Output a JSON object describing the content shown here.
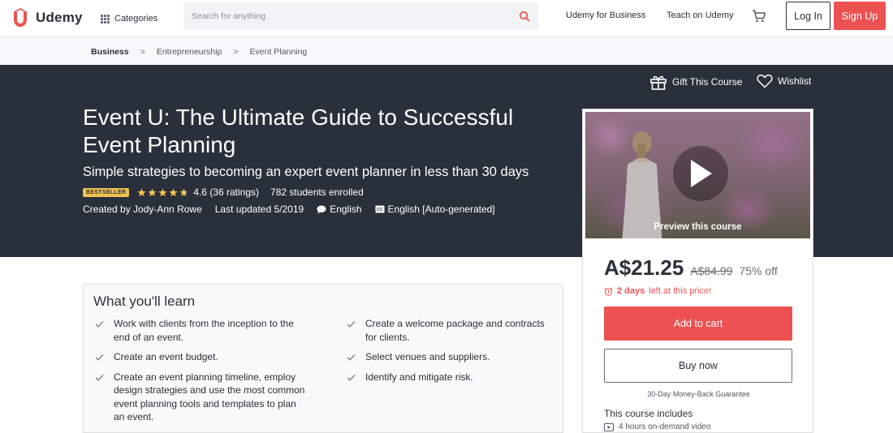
{
  "header": {
    "logo_text": "Udemy",
    "categories_label": "Categories",
    "search_placeholder": "Search for anything",
    "business_link": "Udemy for Business",
    "teach_link": "Teach on Udemy",
    "login_label": "Log In",
    "signup_label": "Sign Up"
  },
  "breadcrumb": [
    "Business",
    "Entrepreneurship",
    "Event Planning"
  ],
  "breadcrumb_separator": ">",
  "hero": {
    "gift_label": "Gift This Course",
    "wishlist_label": "Wishlist",
    "title": "Event U: The Ultimate Guide to Successful Event Planning",
    "subtitle": "Simple strategies to becoming an expert event planner in less than 30 days",
    "badge": "BESTSELLER",
    "rating": "4.6 (36 ratings)",
    "rating_value": 4.6,
    "students": "782 students enrolled",
    "created_by": "Created by Jody-Ann Rowe",
    "last_updated": "Last updated 5/2019",
    "language": "English",
    "captions": "English [Auto-generated]"
  },
  "sidebar": {
    "preview_label": "Preview this course",
    "price_current": "A$21.25",
    "price_original": "A$84.99",
    "discount": "75% off",
    "timer_bold": "2 days",
    "timer_rest": "left at this price!",
    "add_to_cart": "Add to cart",
    "buy_now": "Buy now",
    "guarantee": "30-Day Money-Back Guarantee",
    "includes_title": "This course includes",
    "includes_items": [
      "4 hours on-demand video"
    ]
  },
  "learn": {
    "title": "What you'll learn",
    "left_items": [
      "Work with clients from the inception to the end of an event.",
      "Create an event budget.",
      "Create an event planning timeline, employ design strategies and use the most common event planning tools and templates to plan an event."
    ],
    "right_items": [
      "Create a welcome package and contracts for clients.",
      "Select venues and suppliers.",
      "Identify and mitigate risk."
    ]
  },
  "colors": {
    "brand_red": "#ec5252",
    "hero_bg": "#29303b",
    "badge_yellow": "#f4c150",
    "star": "#f4c150"
  }
}
